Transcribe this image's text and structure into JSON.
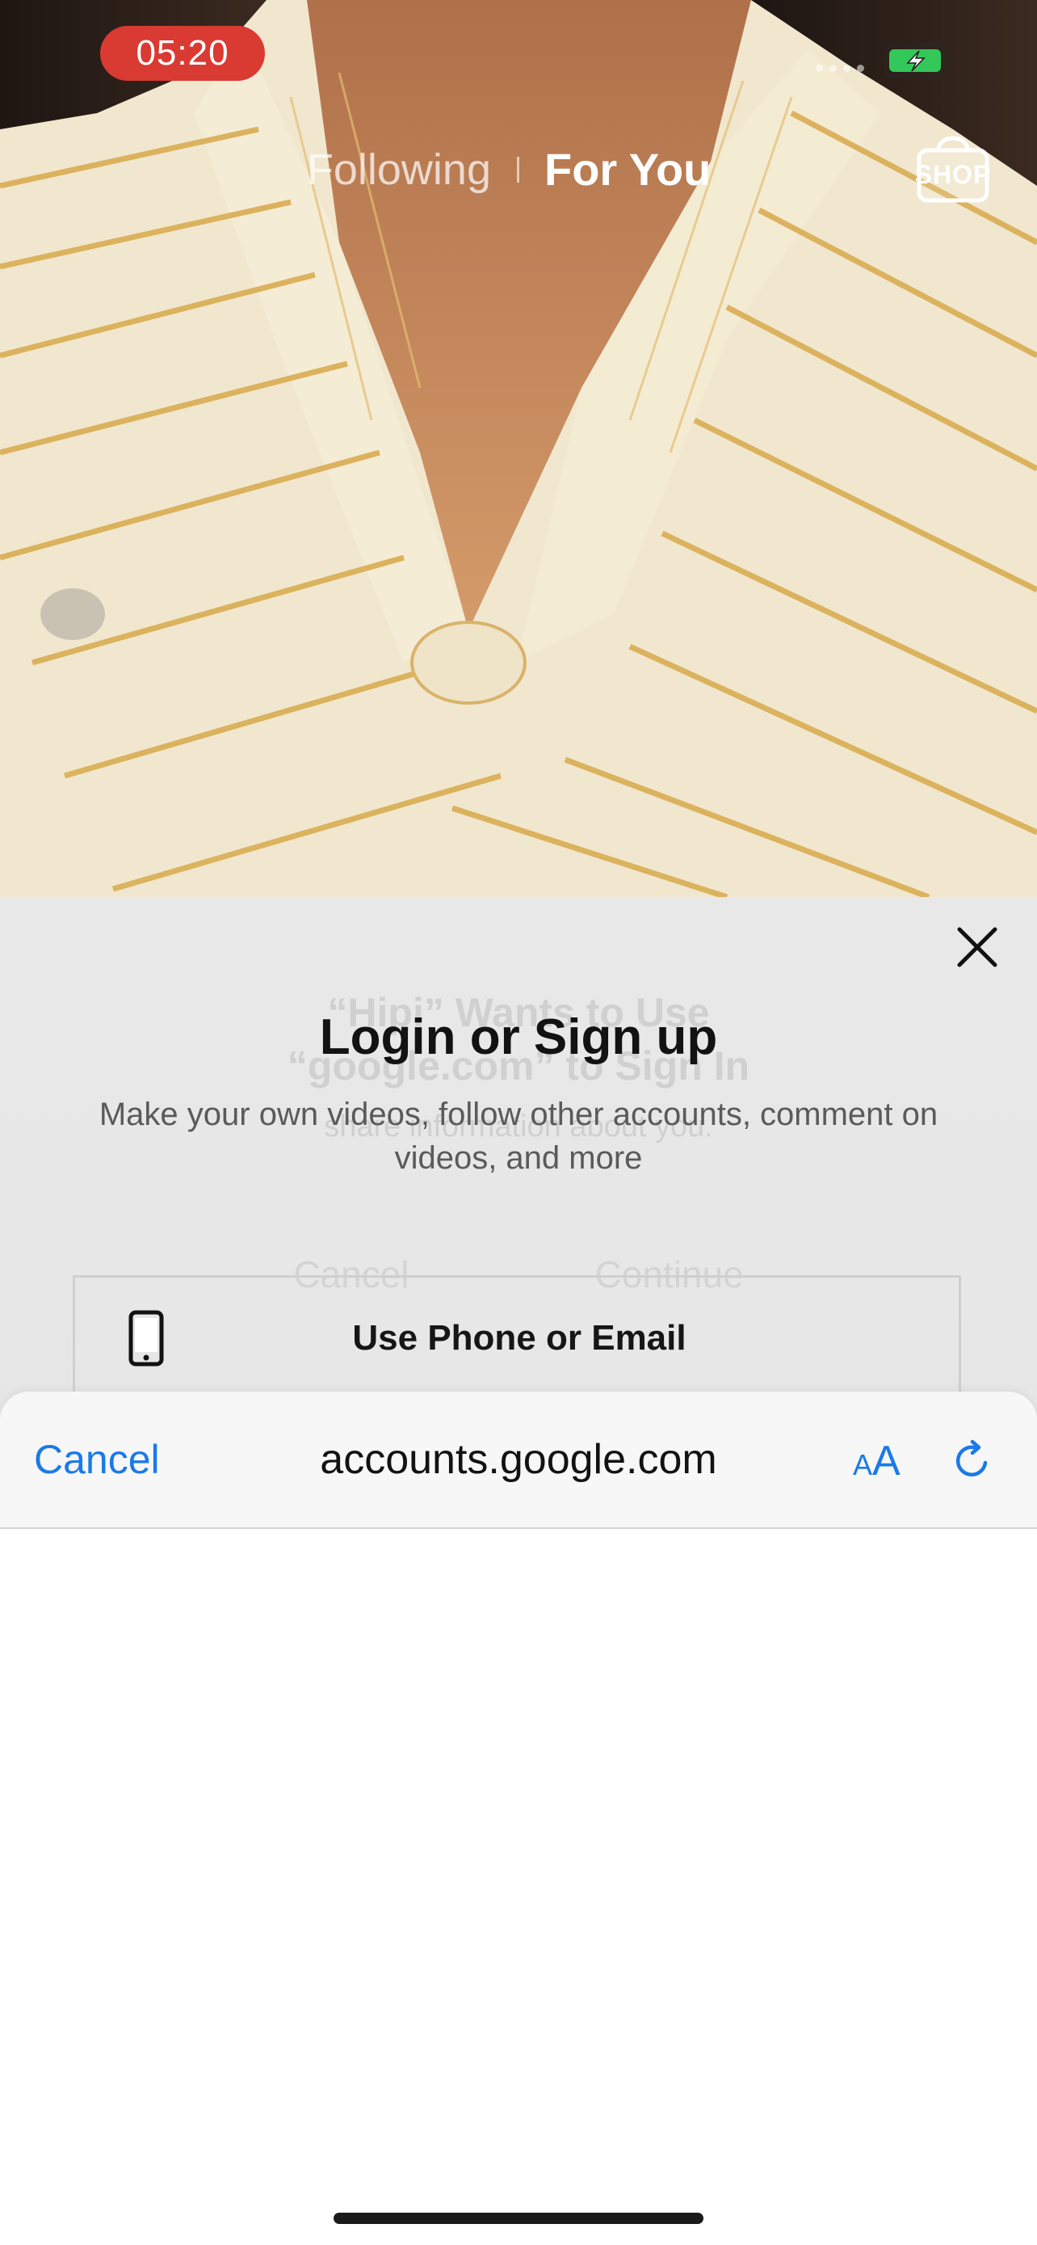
{
  "status_bar": {
    "time": "05:20"
  },
  "top_nav": {
    "following": "Following",
    "for_you": "For You",
    "shop": "SHOP"
  },
  "ghost_alert": {
    "title_line1": "“Hipi” Wants to Use",
    "title_line2": "“google.com” to Sign In",
    "body": "share information about you.",
    "cancel": "Cancel",
    "continue": "Continue"
  },
  "login": {
    "title": "Login or Sign up",
    "subtitle": "Make your own videos, follow other accounts, comment on videos, and more",
    "phone_email_label": "Use Phone or Email"
  },
  "browser": {
    "cancel_label": "Cancel",
    "url": "accounts.google.com"
  },
  "colors": {
    "accent": "#1a7ae8",
    "time_pill": "#d93a32",
    "battery_fill": "#34c759"
  },
  "icons": {
    "close": "close-icon",
    "phone": "phone-icon",
    "text_size": "text-size-icon",
    "reload": "reload-icon",
    "shop_bag": "shopping-bag-icon",
    "battery": "battery-charging-icon"
  }
}
